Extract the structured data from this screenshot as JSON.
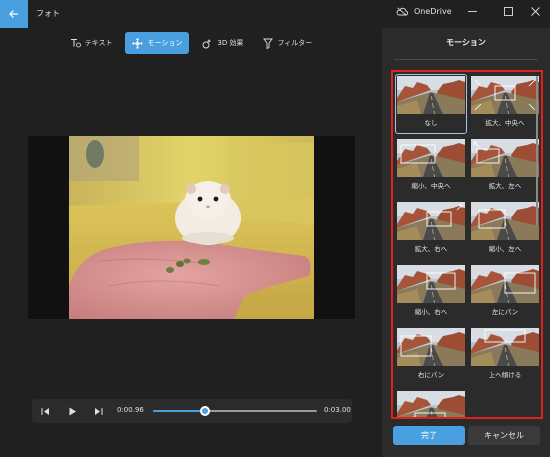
{
  "window": {
    "app_title": "フォト",
    "onedrive_label": "OneDrive",
    "back_icon": "arrow-left-icon",
    "controls": [
      "minimize-icon",
      "maximize-icon",
      "close-icon"
    ]
  },
  "toolbar": {
    "items": [
      {
        "label": "テキスト",
        "icon": "text-icon",
        "active": false
      },
      {
        "label": "モーション",
        "icon": "motion-icon",
        "active": true
      },
      {
        "label": "3D 効果",
        "icon": "3d-effects-icon",
        "active": false
      },
      {
        "label": "フィルター",
        "icon": "filter-icon",
        "active": false
      }
    ]
  },
  "player": {
    "current_time": "0:00.96",
    "total_time": "0:03.00",
    "progress": 0.32
  },
  "motion_panel": {
    "title": "モーション",
    "options": [
      {
        "label": "なし",
        "selected": true
      },
      {
        "label": "拡大、中央へ",
        "selected": false
      },
      {
        "label": "縮小、中央へ",
        "selected": false
      },
      {
        "label": "拡大、左へ",
        "selected": false
      },
      {
        "label": "拡大、右へ",
        "selected": false
      },
      {
        "label": "縮小、左へ",
        "selected": false
      },
      {
        "label": "縮小、右へ",
        "selected": false
      },
      {
        "label": "左にパン",
        "selected": false
      },
      {
        "label": "右にパン",
        "selected": false
      },
      {
        "label": "上へ傾ける",
        "selected": false
      },
      {
        "label": "",
        "selected": false
      }
    ],
    "done_label": "完了",
    "cancel_label": "キャンセル"
  },
  "colors": {
    "accent": "#4a9fe0",
    "highlight_frame": "#e0201a",
    "panel_bg": "#2b2b2b",
    "app_bg": "#202020"
  }
}
